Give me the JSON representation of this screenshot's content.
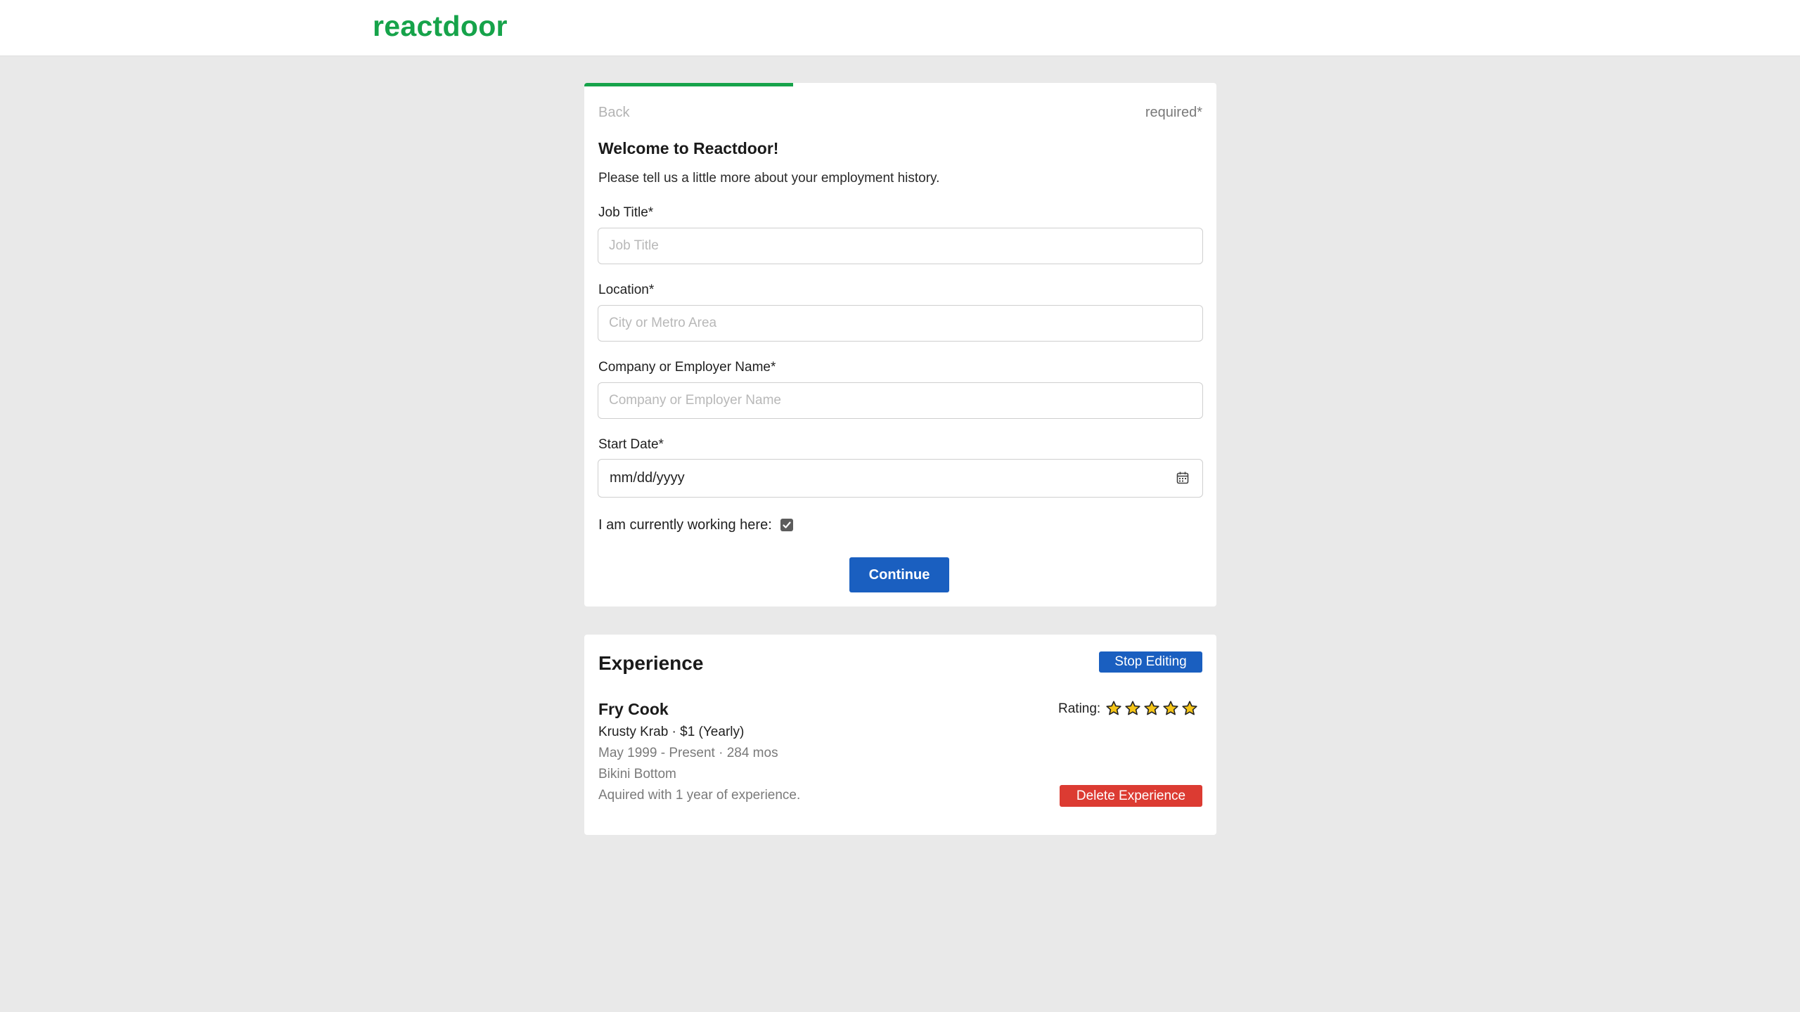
{
  "header": {
    "logo": "reactdoor",
    "brand_color": "#16a34a"
  },
  "form": {
    "progress_fraction": 0.33,
    "back_label": "Back",
    "required_note": "required*",
    "welcome": "Welcome to Reactdoor!",
    "intro": "Please tell us a little more about your employment history.",
    "job_title": {
      "label": "Job Title*",
      "value": "",
      "placeholder": "Job Title"
    },
    "location": {
      "label": "Location*",
      "value": "",
      "placeholder": "City or Metro Area"
    },
    "company": {
      "label": "Company or Employer Name*",
      "value": "",
      "placeholder": "Company or Employer Name"
    },
    "start_date": {
      "label": "Start Date*",
      "value": "mm/dd/yyyy",
      "icon": "calendar-icon"
    },
    "currently_working": {
      "label": "I am currently working here:",
      "checked": true
    },
    "continue_label": "Continue",
    "button_color": "#1a5fc0"
  },
  "experience": {
    "title": "Experience",
    "stop_editing_label": "Stop Editing",
    "items": [
      {
        "job_title": "Fry Cook",
        "company_line": "Krusty Krab · $1 (Yearly)",
        "dates_line": "May 1999 - Present · 284 mos",
        "location": "Bikini Bottom",
        "note": "Aquired with 1 year of experience.",
        "rating_label": "Rating:",
        "rating": 5,
        "rating_max": 5,
        "star_color": "#f5c518",
        "delete_label": "Delete Experience",
        "delete_color": "#dc3b32"
      }
    ]
  }
}
